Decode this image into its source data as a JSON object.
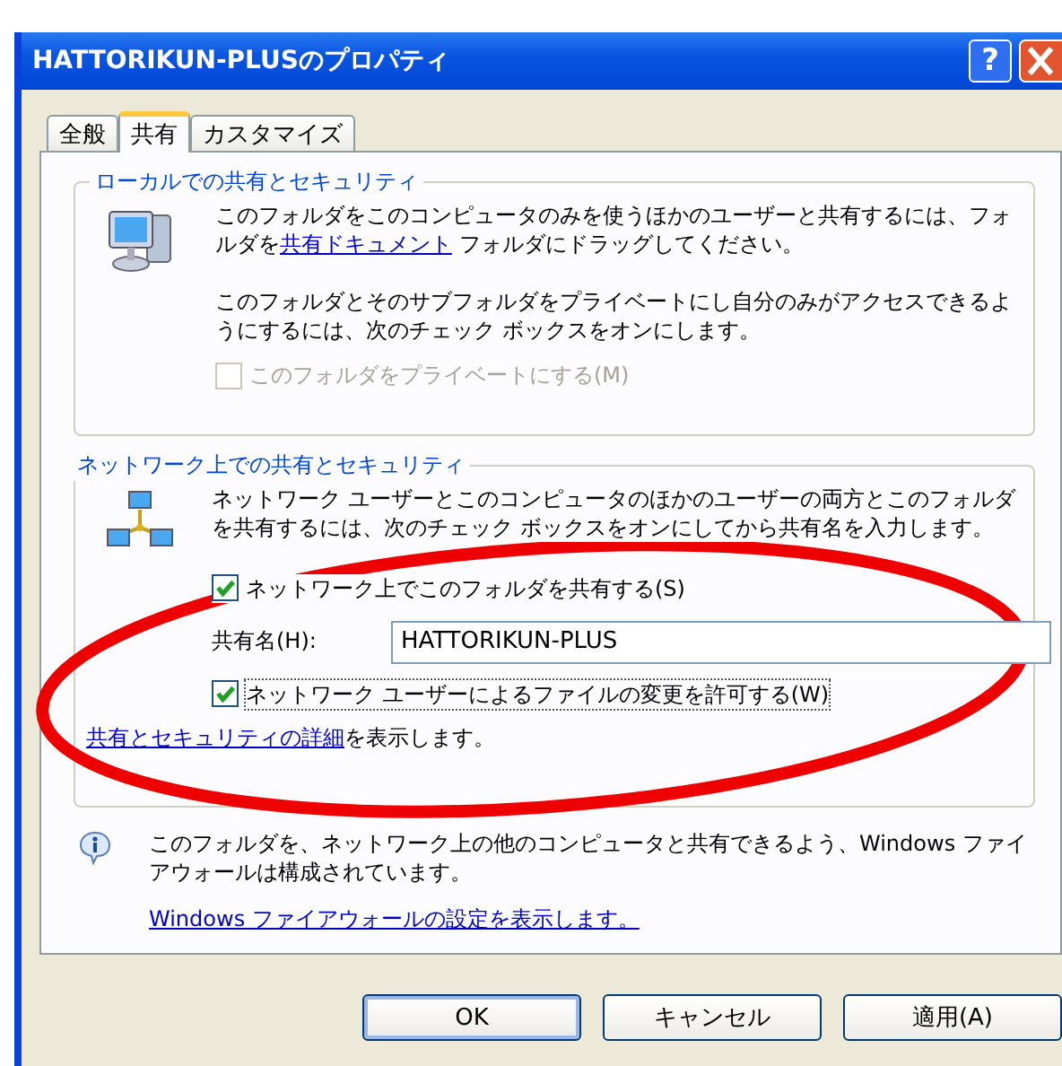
{
  "window": {
    "title": "HATTORIKUN-PLUSのプロパティ",
    "help_button": "?"
  },
  "tabs": [
    {
      "label": "全般",
      "selected": false
    },
    {
      "label": "共有",
      "selected": true
    },
    {
      "label": "カスタマイズ",
      "selected": false
    }
  ],
  "local_group": {
    "title": "ローカルでの共有とセキュリティ",
    "text_before": "このフォルダをこのコンピュータのみを使うほかのユーザーと共有するには、フォルダを",
    "link": "共有ドキュメント",
    "text_after": " フォルダにドラッグしてください。",
    "text2": "このフォルダとそのサブフォルダをプライベートにし自分のみがアクセスできるようにするには、次のチェック ボックスをオンにします。",
    "checkbox": {
      "label": "このフォルダをプライベートにする(M)",
      "checked": false,
      "disabled": true
    }
  },
  "network_group": {
    "title": "ネットワーク上での共有とセキュリティ",
    "text": "ネットワーク ユーザーとこのコンピュータのほかのユーザーの両方とこのフォルダを共有するには、次のチェック ボックスをオンにしてから共有名を入力します。",
    "share_checkbox": {
      "label": "ネットワーク上でこのフォルダを共有する(S)",
      "checked": true
    },
    "share_name": {
      "label": "共有名(H):",
      "value": "HATTORIKUN-PLUS"
    },
    "allow_checkbox": {
      "label": "ネットワーク ユーザーによるファイルの変更を許可する(W)",
      "checked": true
    },
    "details_link": "共有とセキュリティの詳細",
    "details_after": "を表示します。"
  },
  "firewall": {
    "text": "このフォルダを、ネットワーク上の他のコンピュータと共有できるよう、Windows ファイアウォールは構成されています。",
    "link": "Windows ファイアウォールの設定を表示します。"
  },
  "buttons": [
    {
      "label": "OK",
      "default": true
    },
    {
      "label": "キャンセル",
      "default": false
    },
    {
      "label": "適用(A)",
      "default": false
    }
  ]
}
